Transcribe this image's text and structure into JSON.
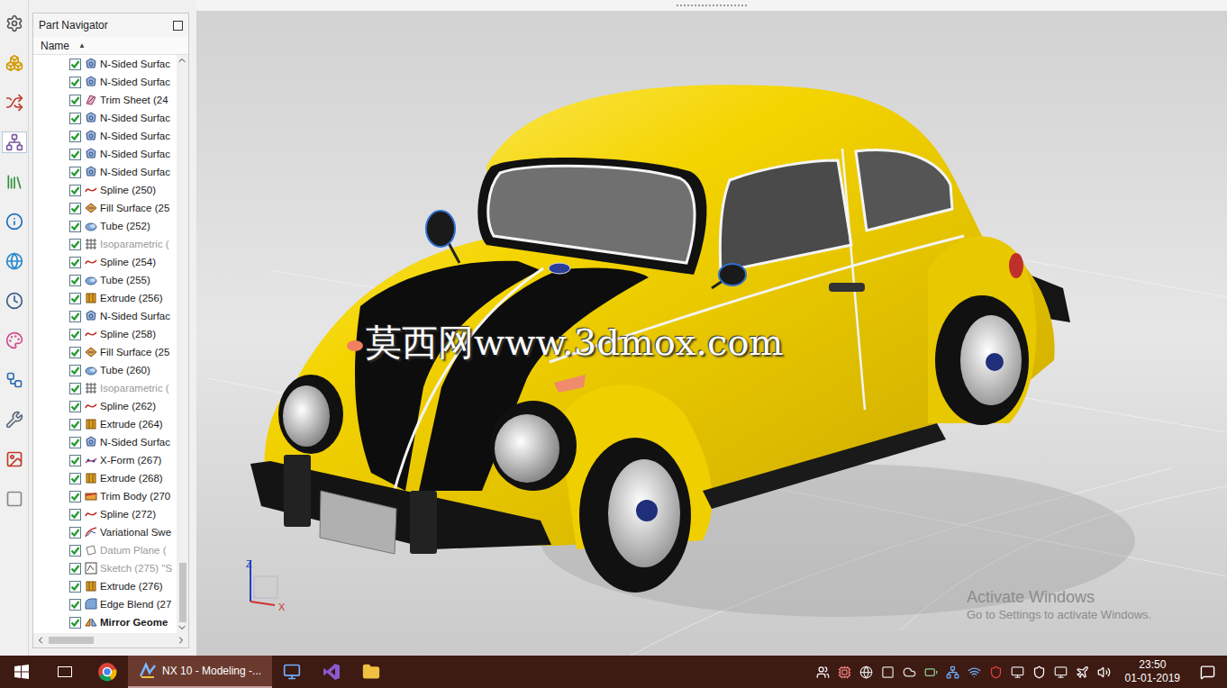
{
  "toolbar": {
    "items": [
      {
        "selected": false
      },
      {
        "selected": false
      },
      {
        "selected": false
      },
      {
        "selected": true
      },
      {
        "selected": false
      },
      {
        "selected": false
      },
      {
        "selected": false
      },
      {
        "selected": false
      },
      {
        "selected": false
      },
      {
        "selected": false
      },
      {
        "selected": false
      },
      {
        "selected": false
      },
      {
        "selected": false
      }
    ]
  },
  "navigator": {
    "title": "Part Navigator",
    "column": "Name",
    "sort_indicator": "▲",
    "rows": [
      {
        "label": "N-Sided Surfac",
        "kind": "nsided",
        "checked": true,
        "greyed": false,
        "bold": false
      },
      {
        "label": "N-Sided Surfac",
        "kind": "nsided",
        "checked": true,
        "greyed": false,
        "bold": false
      },
      {
        "label": "Trim Sheet (24",
        "kind": "trim",
        "checked": true,
        "greyed": false,
        "bold": false
      },
      {
        "label": "N-Sided Surfac",
        "kind": "nsided",
        "checked": true,
        "greyed": false,
        "bold": false
      },
      {
        "label": "N-Sided Surfac",
        "kind": "nsided",
        "checked": true,
        "greyed": false,
        "bold": false
      },
      {
        "label": "N-Sided Surfac",
        "kind": "nsided",
        "checked": true,
        "greyed": false,
        "bold": false
      },
      {
        "label": "N-Sided Surfac",
        "kind": "nsided",
        "checked": true,
        "greyed": false,
        "bold": false
      },
      {
        "label": "Spline (250)",
        "kind": "spline",
        "checked": true,
        "greyed": false,
        "bold": false
      },
      {
        "label": "Fill Surface (25",
        "kind": "fill",
        "checked": true,
        "greyed": false,
        "bold": false
      },
      {
        "label": "Tube (252)",
        "kind": "tube",
        "checked": true,
        "greyed": false,
        "bold": false
      },
      {
        "label": "Isoparametric (",
        "kind": "iso",
        "checked": true,
        "greyed": true,
        "bold": false
      },
      {
        "label": "Spline (254)",
        "kind": "spline",
        "checked": true,
        "greyed": false,
        "bold": false
      },
      {
        "label": "Tube (255)",
        "kind": "tube",
        "checked": true,
        "greyed": false,
        "bold": false
      },
      {
        "label": "Extrude (256)",
        "kind": "extrude",
        "checked": true,
        "greyed": false,
        "bold": false
      },
      {
        "label": "N-Sided Surfac",
        "kind": "nsided",
        "checked": true,
        "greyed": false,
        "bold": false
      },
      {
        "label": "Spline (258)",
        "kind": "spline",
        "checked": true,
        "greyed": false,
        "bold": false
      },
      {
        "label": "Fill Surface (25",
        "kind": "fill",
        "checked": true,
        "greyed": false,
        "bold": false
      },
      {
        "label": "Tube (260)",
        "kind": "tube",
        "checked": true,
        "greyed": false,
        "bold": false
      },
      {
        "label": "Isoparametric (",
        "kind": "iso",
        "checked": true,
        "greyed": true,
        "bold": false
      },
      {
        "label": "Spline (262)",
        "kind": "spline",
        "checked": true,
        "greyed": false,
        "bold": false
      },
      {
        "label": "Extrude (264)",
        "kind": "extrude",
        "checked": true,
        "greyed": false,
        "bold": false
      },
      {
        "label": "N-Sided Surfac",
        "kind": "nsided",
        "checked": true,
        "greyed": false,
        "bold": false
      },
      {
        "label": "X-Form (267)",
        "kind": "xform",
        "checked": true,
        "greyed": false,
        "bold": false
      },
      {
        "label": "Extrude (268)",
        "kind": "extrude",
        "checked": true,
        "greyed": false,
        "bold": false
      },
      {
        "label": "Trim Body (270",
        "kind": "trimbody",
        "checked": true,
        "greyed": false,
        "bold": false
      },
      {
        "label": "Spline (272)",
        "kind": "spline",
        "checked": true,
        "greyed": false,
        "bold": false
      },
      {
        "label": "Variational Swe",
        "kind": "sweep",
        "checked": true,
        "greyed": false,
        "bold": false
      },
      {
        "label": "Datum Plane (",
        "kind": "datum",
        "checked": true,
        "greyed": true,
        "bold": false
      },
      {
        "label": "Sketch (275) \"S",
        "kind": "sketch",
        "checked": true,
        "greyed": true,
        "bold": false
      },
      {
        "label": "Extrude (276)",
        "kind": "extrude",
        "checked": true,
        "greyed": false,
        "bold": false
      },
      {
        "label": "Edge Blend (27",
        "kind": "blend",
        "checked": true,
        "greyed": false,
        "bold": false
      },
      {
        "label": "Mirror Geome",
        "kind": "mirror",
        "checked": true,
        "greyed": false,
        "bold": true
      }
    ]
  },
  "viewport": {
    "watermark": "莫西网www.3dmox.com",
    "axes": {
      "z": "Z",
      "x": "X"
    },
    "activation": {
      "title": "Activate Windows",
      "subtitle": "Go to Settings to activate Windows."
    }
  },
  "taskbar": {
    "apps": [
      {
        "kind": "chrome",
        "label": "",
        "active": false
      },
      {
        "kind": "nx",
        "label": "NX 10 - Modeling -...",
        "active": true
      },
      {
        "kind": "monitor",
        "label": "",
        "active": false
      },
      {
        "kind": "vs",
        "label": "",
        "active": false
      },
      {
        "kind": "folder",
        "label": "",
        "active": false
      }
    ],
    "clock": {
      "time": "23:50",
      "date": "01-01-2019"
    }
  }
}
